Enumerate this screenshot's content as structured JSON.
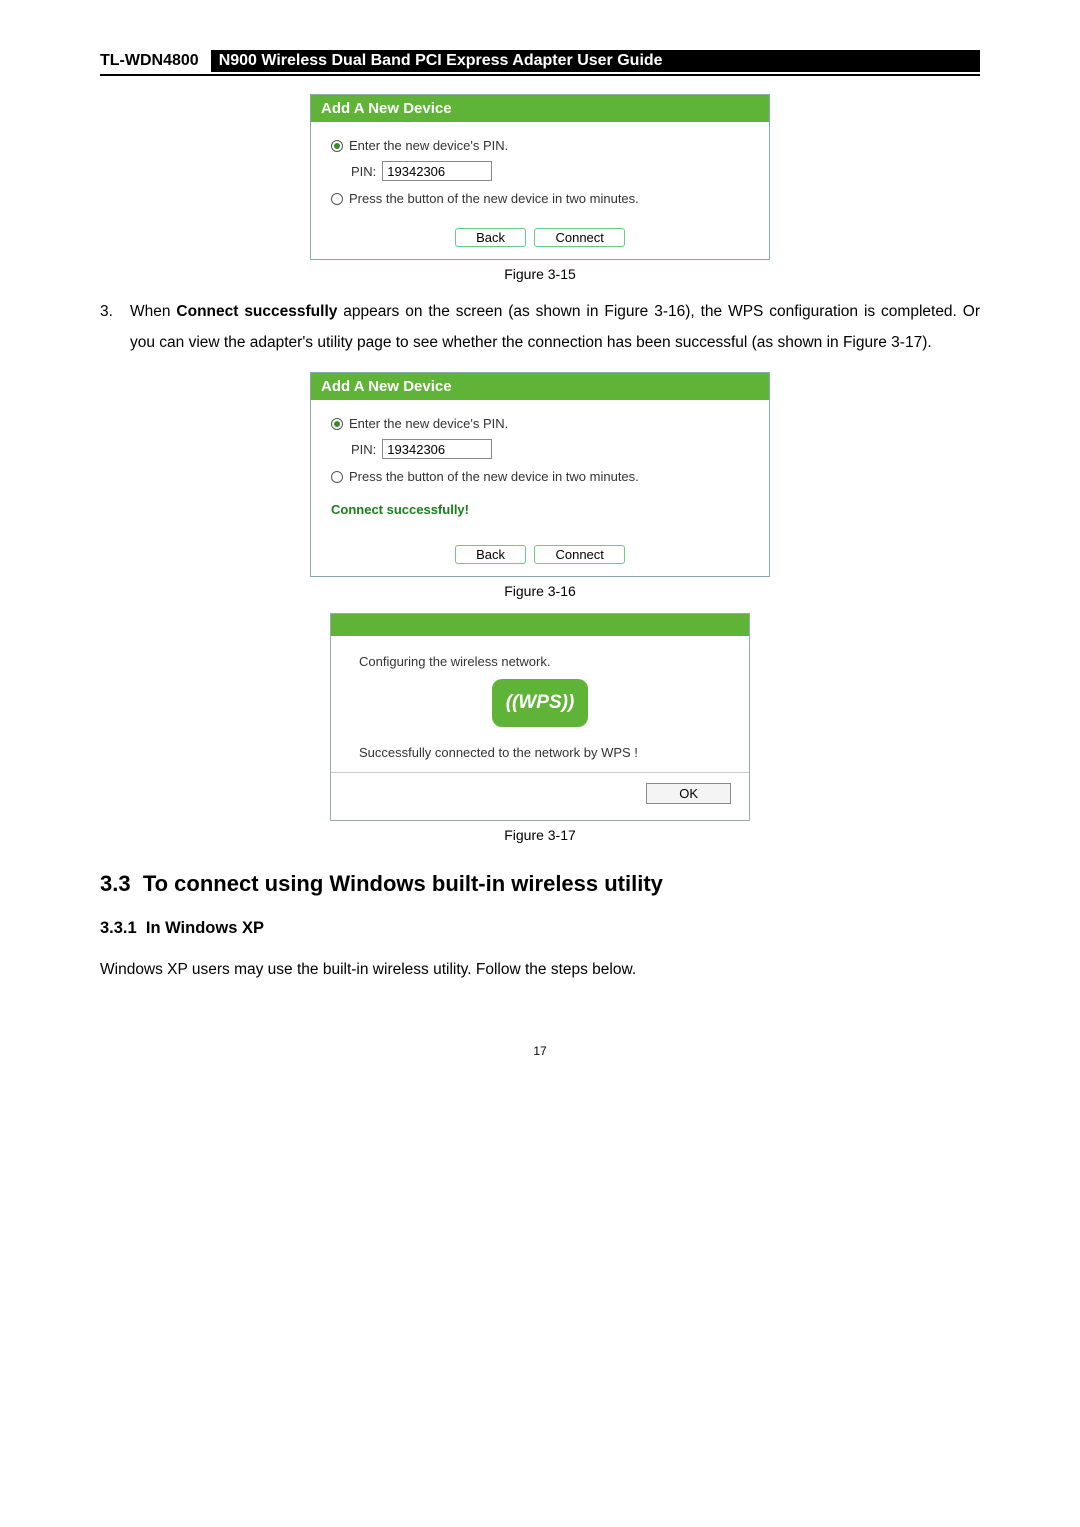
{
  "header": {
    "model": "TL-WDN4800",
    "title": "N900 Wireless Dual Band PCI Express Adapter User Guide"
  },
  "dialog1": {
    "title": "Add A New Device",
    "opt1": "Enter the new device's PIN.",
    "pinLabel": "PIN:",
    "pinValue": "19342306",
    "opt2": "Press the button of the new device in two minutes.",
    "back": "Back",
    "connect": "Connect",
    "caption": "Figure 3-15"
  },
  "para3": {
    "num": "3.",
    "t1": "When ",
    "bold1": "Connect successfully",
    "t2": " appears on the screen (as shown in Figure 3-16), the WPS configuration is completed. Or you can view the adapter's utility page to see whether the connection has been successful (as shown in Figure 3-17)."
  },
  "dialog2": {
    "title": "Add A New Device",
    "opt1": "Enter the new device's PIN.",
    "pinLabel": "PIN:",
    "pinValue": "19342306",
    "opt2": "Press the button of the new device in two minutes.",
    "status": "Connect successfully!",
    "back": "Back",
    "connect": "Connect",
    "caption": "Figure 3-16"
  },
  "wps": {
    "configuring": "Configuring the wireless network.",
    "badge": "((WPS))",
    "success": "Successfully connected to the network by WPS !",
    "ok": "OK",
    "caption": "Figure 3-17"
  },
  "sec33": {
    "num": "3.3",
    "title": "To connect using Windows built-in wireless utility"
  },
  "sec331": {
    "num": "3.3.1",
    "title": "In Windows XP"
  },
  "xpText": "Windows XP users may use the built-in wireless utility. Follow the steps below.",
  "pageNumber": "17"
}
